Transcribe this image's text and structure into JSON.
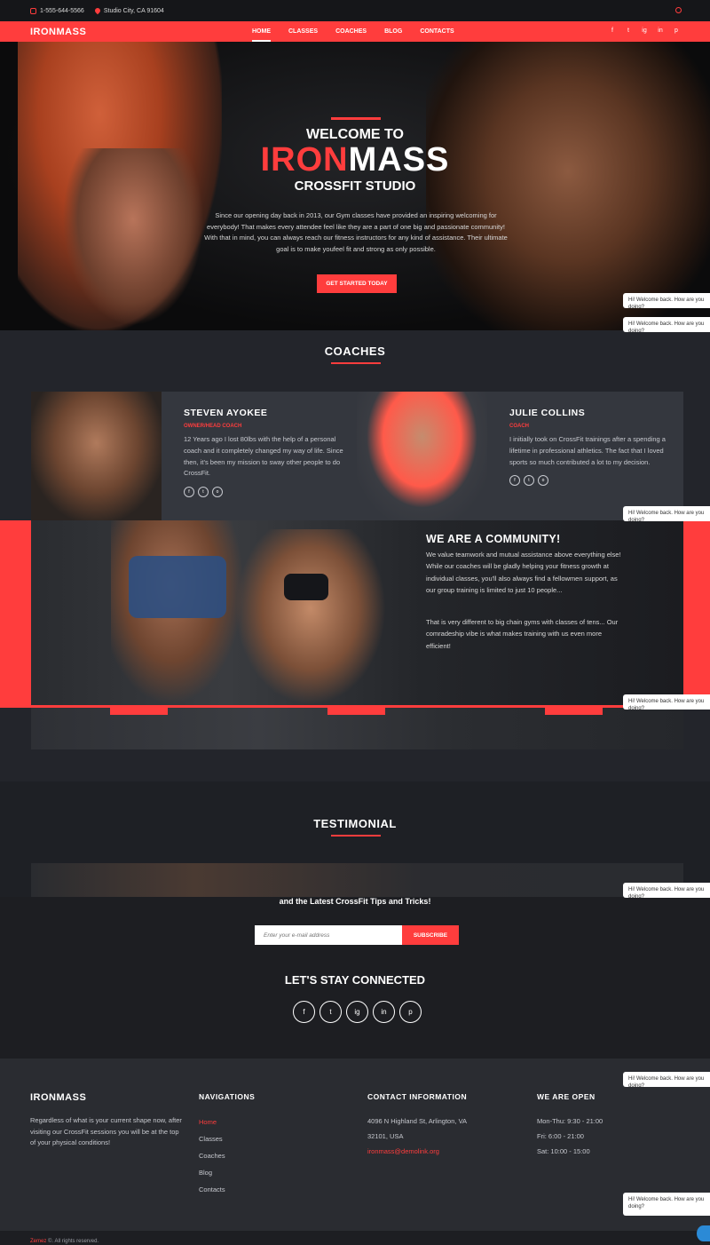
{
  "topbar": {
    "phone": "1-555-644-5566",
    "location": "Studio City, CA 91604"
  },
  "nav": {
    "logo": "IRONMASS",
    "items": [
      "HOME",
      "CLASSES",
      "COACHES",
      "BLOG",
      "CONTACTS"
    ],
    "social": [
      "f",
      "t",
      "ig",
      "in",
      "p"
    ]
  },
  "hero": {
    "pre": "WELCOME TO",
    "title_red": "IRON",
    "title_white": "MASS",
    "subtitle": "CROSSFIT STUDIO",
    "text": "Since our opening day back in 2013, our Gym classes have provided an inspiring welcoming for everybody! That makes every attendee feel like they are a part of one big and passionate community! With that in mind, you can always reach our fitness instructors for any kind of assistance. Their ultimate goal is to make youfeel fit and strong as only possible.",
    "cta": "GET STARTED TODAY"
  },
  "coaches": {
    "title": "COACHES",
    "items": [
      {
        "name": "STEVEN AYOKEE",
        "role": "OWNER/HEAD COACH",
        "bio": "12 Years ago I lost 80lbs with the help of a personal coach and it completely changed my way of life. Since then, it's been my mission to sway other people to do CrossFit."
      },
      {
        "name": "JULIE COLLINS",
        "role": "COACH",
        "bio": "I initially took on CrossFit trainings after a spending a lifetime in professional athletics. The fact that I loved sports so much contributed a lot to my decision."
      }
    ]
  },
  "community": {
    "title": "WE ARE A COMMUNITY!",
    "p1": "We value teamwork and mutual assistance above everything else! While our coaches will be gladly helping your fitness growth at individual classes, you'll also always find a fellowmen support, as our group training is limited to just 10 people...",
    "p2": "That is very different to big chain gyms with classes of tens... Our comradeship vibe is what makes training with us even more efficient!"
  },
  "testimonial": {
    "title": "TESTIMONIAL"
  },
  "subscribe": {
    "lead": "and the Latest CrossFit Tips and Tricks!",
    "placeholder": "Enter your e-mail address",
    "button": "SUBSCRIBE",
    "stay": "LET'S STAY CONNECTED",
    "social": [
      "f",
      "t",
      "ig",
      "in",
      "p"
    ]
  },
  "footer": {
    "brand": "IRONMASS",
    "about": "Regardless of what is your current shape now, after visiting our CrossFit sessions you will be at the top of your physical conditions!",
    "nav_head": "NAVIGATIONS",
    "nav": [
      "Home",
      "Classes",
      "Coaches",
      "Blog",
      "Contacts"
    ],
    "contact_head": "CONTACT INFORMATION",
    "address1": "4096 N Highland St, Arlington, VA",
    "address2": "32101, USA",
    "email": "ironmass@demolink.org",
    "open_head": "WE ARE OPEN",
    "hours": [
      "Mon-Thu: 9:30 - 21:00",
      "Fri: 6:00 - 21:00",
      "Sat: 10:00 - 15:00"
    ]
  },
  "copyright": {
    "brand": "Zemez",
    "text": "©. All rights reserved."
  },
  "chat": {
    "message": "Hi! Welcome back. How are you doing?"
  },
  "colors": {
    "accent": "#ff3d3d",
    "dark": "#1e2025"
  }
}
